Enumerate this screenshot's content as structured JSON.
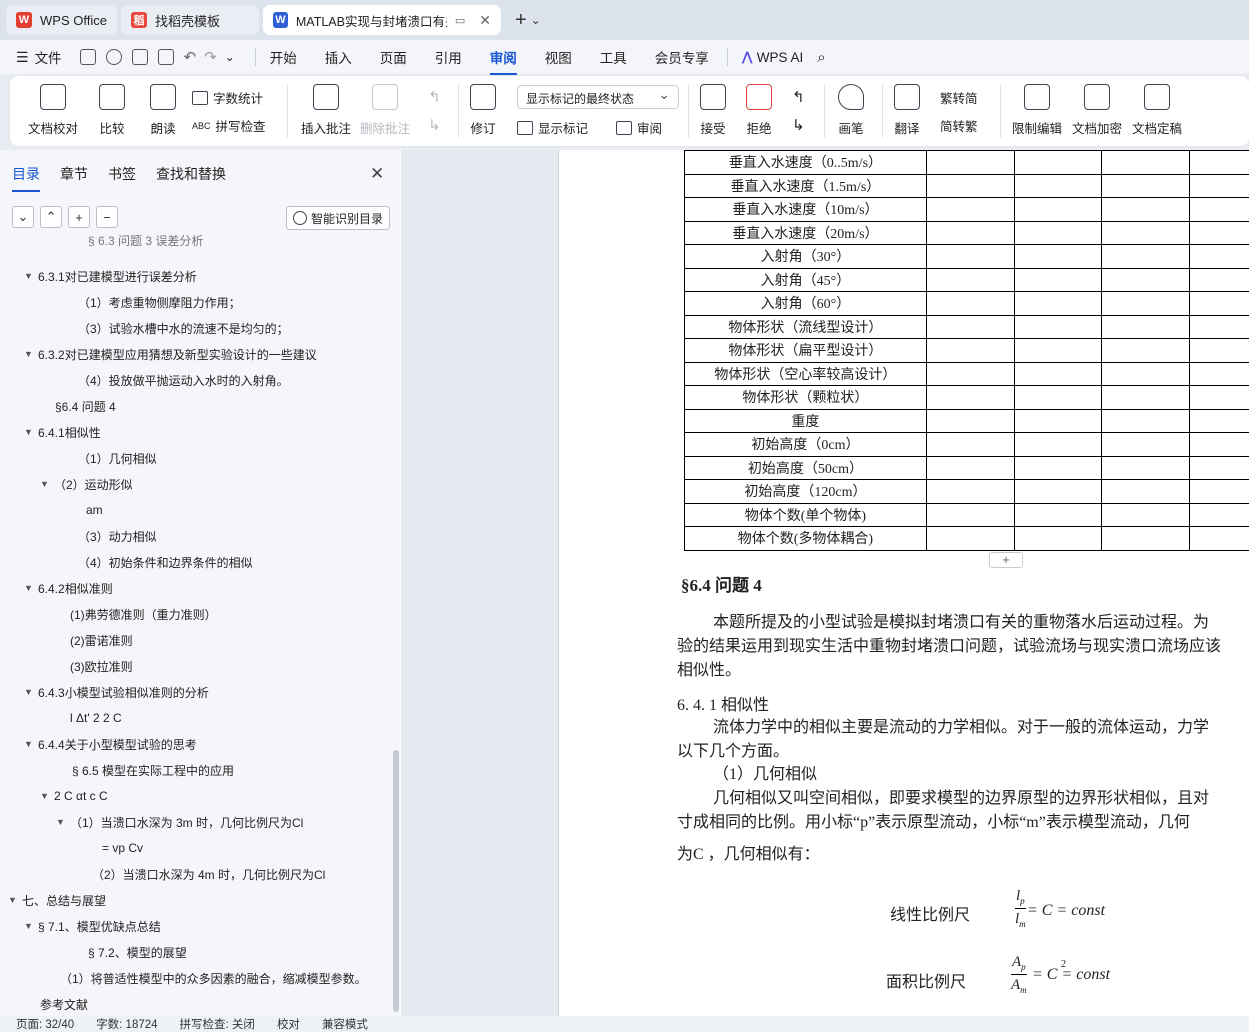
{
  "tabs": [
    {
      "label": "WPS Office",
      "logo_color": "#e23d2f",
      "logo": "W"
    },
    {
      "label": "找稻壳模板",
      "logo_color": "#e8483b",
      "logo": "稻"
    },
    {
      "label": "MATLAB实现与封堵溃口有关",
      "logo_color": "#2f5fd7",
      "logo": "W"
    }
  ],
  "menu": {
    "file": "文件",
    "items": [
      "开始",
      "插入",
      "页面",
      "引用",
      "审阅",
      "视图",
      "工具",
      "会员专享"
    ],
    "active": "审阅",
    "ai": "WPS AI"
  },
  "ribbon": {
    "doc_proof": "文档校对",
    "compare": "比较",
    "read_aloud": "朗读",
    "word_count": "字数统计",
    "spell_check": "拼写检查",
    "insert_comment": "插入批注",
    "delete_comment": "删除批注",
    "revise": "修订",
    "markup_state": "显示标记的最终状态",
    "show_markup": "显示标记",
    "review": "审阅",
    "accept": "接受",
    "reject": "拒绝",
    "pen": "画笔",
    "translate": "翻译",
    "to_simplified": "繁转简",
    "simp_trad": "简转繁",
    "restrict_edit": "限制编辑",
    "doc_encrypt": "文档加密",
    "doc_finalize": "文档定稿"
  },
  "nav": {
    "tabs": [
      "目录",
      "章节",
      "书签",
      "查找和替换"
    ],
    "active_tab": "目录",
    "buttons": [
      "⌄",
      "⌃",
      "+",
      "−"
    ],
    "smart_btn": "智能识别目录",
    "toc": [
      {
        "text": "§ 6.3 问题 3 误差分析",
        "indent": 88,
        "caret": ""
      },
      {
        "text": "6.3.1对已建模型进行误差分析",
        "indent": 40,
        "caret": "▼"
      },
      {
        "text": "（1）考虑重物侧摩阻力作用；",
        "indent": 78,
        "caret": ""
      },
      {
        "text": "（3）试验水槽中水的流速不是均匀的；",
        "indent": 78,
        "caret": ""
      },
      {
        "text": "6.3.2对已建模型应用猜想及新型实验设计的一些建议",
        "indent": 40,
        "caret": "▼"
      },
      {
        "text": "（4）投放做平抛运动入水时的入射角。",
        "indent": 78,
        "caret": ""
      },
      {
        "text": "§6.4 问题 4",
        "indent": 55,
        "caret": ""
      },
      {
        "text": "6.4.1相似性",
        "indent": 40,
        "caret": "▼"
      },
      {
        "text": "（1）几何相似",
        "indent": 78,
        "caret": ""
      },
      {
        "text": "（2）运动形似",
        "indent": 56,
        "caret": "▼"
      },
      {
        "text": "am",
        "indent": 86,
        "caret": ""
      },
      {
        "text": "（3）动力相似",
        "indent": 78,
        "caret": ""
      },
      {
        "text": "（4）初始条件和边界条件的相似",
        "indent": 78,
        "caret": ""
      },
      {
        "text": "6.4.2相似准则",
        "indent": 40,
        "caret": "▼"
      },
      {
        "text": "(1)弗劳德准则（重力准则）",
        "indent": 70,
        "caret": ""
      },
      {
        "text": "(2)雷诺准则",
        "indent": 70,
        "caret": ""
      },
      {
        "text": "(3)欧拉准则",
        "indent": 70,
        "caret": ""
      },
      {
        "text": "6.4.3小模型试验相似准则的分析",
        "indent": 40,
        "caret": "▼"
      },
      {
        "text": "l Δt' 2    2 C",
        "indent": 70,
        "caret": ""
      },
      {
        "text": "6.4.4关于小型模型试验的思考",
        "indent": 40,
        "caret": "▼"
      },
      {
        "text": "§ 6.5 模型在实际工程中的应用",
        "indent": 72,
        "caret": ""
      },
      {
        "text": "2    C αt    c C",
        "indent": 56,
        "caret": "▼"
      },
      {
        "text": "（1）当溃口水深为 3m 时，几何比例尺为Cl",
        "indent": 72,
        "caret": "▼"
      },
      {
        "text": "= vp Cv",
        "indent": 102,
        "caret": ""
      },
      {
        "text": "（2）当溃口水深为 4m 时，几何比例尺为Cl",
        "indent": 92,
        "caret": ""
      },
      {
        "text": "七、总结与展望",
        "indent": 24,
        "caret": "▼"
      },
      {
        "text": "§ 7.1、模型优缺点总结",
        "indent": 40,
        "caret": "▼"
      },
      {
        "text": "§ 7.2、模型的展望",
        "indent": 88,
        "caret": ""
      },
      {
        "text": "（1）将普适性模型中的众多因素的融合，缩减模型参数。",
        "indent": 60,
        "caret": ""
      },
      {
        "text": "参考文献",
        "indent": 40,
        "caret": ""
      }
    ]
  },
  "doc": {
    "table_rows": [
      "垂直入水速度（0..5m/s）",
      "垂直入水速度（1.5m/s）",
      "垂直入水速度（10m/s）",
      "垂直入水速度（20m/s）",
      "入射角（30°）",
      "入射角（45°）",
      "入射角（60°）",
      "物体形状（流线型设计）",
      "物体形状（扁平型设计）",
      "物体形状（空心率较高设计）",
      "物体形状（颗粒状）",
      "重度",
      "初始高度（0cm）",
      "初始高度（50cm）",
      "初始高度（120cm）",
      "物体个数(单个物体)",
      "物体个数(多物体耦合)"
    ],
    "table_plus": "+",
    "section_title": "§6.4 问题 4",
    "paragraphs": [
      "本题所提及的小型试验是模拟封堵溃口有关的重物落水后运动过程。为",
      "验的结果运用到现实生活中重物封堵溃口问题，试验流场与现实溃口流场应该",
      "相似性。"
    ],
    "sub_title": "6. 4. 1 相似性",
    "sub_paragraphs": [
      "流体力学中的相似主要是流动的力学相似。对于一般的流体运动，力学",
      "以下几个方面。",
      "（1）几何相似",
      "几何相似又叫空间相似，即要求模型的边界原型的边界形状相似，且对",
      "寸成相同的比例。用小标“p”表示原型流动，小标“m”表示模型流动，几何",
      "为C  ，几何相似有："
    ],
    "formula1_label": "线性比例尺",
    "formula1_num": "l",
    "formula1_num_sub": "p",
    "formula1_den": "l",
    "formula1_den_sub": "m",
    "formula1_rhs": "= C  = const",
    "formula2_label": "面积比例尺",
    "formula2_num": "A",
    "formula2_num_sub": "p",
    "formula2_den": "A",
    "formula2_den_sub": "m",
    "formula2_rhs": "= C  = const",
    "formula2_sup": "2"
  },
  "status": {
    "page": "页面: 32/40",
    "words": "字数: 18724",
    "spell": "拼写检查: 关闭",
    "proof": "校对",
    "compat": "兼容模式"
  }
}
